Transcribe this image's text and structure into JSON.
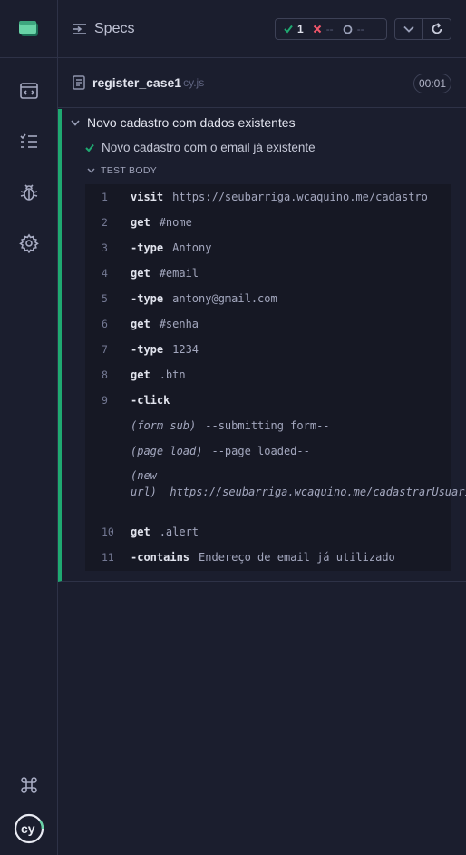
{
  "sidebar": {
    "items": [
      {
        "icon": "browser-icon"
      },
      {
        "icon": "list-icon"
      },
      {
        "icon": "bug-icon"
      },
      {
        "icon": "gear-icon"
      }
    ],
    "bottom": [
      {
        "icon": "command-key-icon"
      },
      {
        "icon": "cypress-logo-icon"
      }
    ]
  },
  "header": {
    "title": "Specs",
    "passed": "1",
    "failed": "--",
    "pending": "--"
  },
  "spec": {
    "name": "register_case1",
    "ext": "cy.js",
    "duration": "00:01"
  },
  "suite": {
    "title": "Novo cadastro com dados existentes",
    "test_title": "Novo cadastro com o email já existente",
    "body_label": "TEST BODY"
  },
  "commands": [
    {
      "num": "1",
      "name": "visit",
      "msg": "https://seubarriga.wcaquino.me/cadastro"
    },
    {
      "num": "2",
      "name": "get",
      "msg": "#nome"
    },
    {
      "num": "3",
      "name": "-type",
      "msg": "Antony"
    },
    {
      "num": "4",
      "name": "get",
      "msg": "#email"
    },
    {
      "num": "5",
      "name": "-type",
      "msg": "antony@gmail.com"
    },
    {
      "num": "6",
      "name": "get",
      "msg": "#senha"
    },
    {
      "num": "7",
      "name": "-type",
      "msg": "1234"
    },
    {
      "num": "8",
      "name": "get",
      "msg": ".btn"
    },
    {
      "num": "9",
      "name": "-click",
      "msg": ""
    },
    {
      "num": "",
      "name": "(form sub)",
      "msg": "--submitting form--"
    },
    {
      "num": "",
      "name": "(page load)",
      "msg": "--page loaded--"
    },
    {
      "num": "",
      "name": "(new url)",
      "msg": "https://seubarriga.wcaquino.me/cadastrarUsuario"
    },
    {
      "num": "10",
      "name": "get",
      "msg": ".alert"
    },
    {
      "num": "11",
      "name": "-contains",
      "msg": "Endereço de email já utilizado"
    }
  ],
  "colors": {
    "pass": "#1fa971",
    "fail": "#f1566b",
    "background": "#1b1e2e"
  }
}
